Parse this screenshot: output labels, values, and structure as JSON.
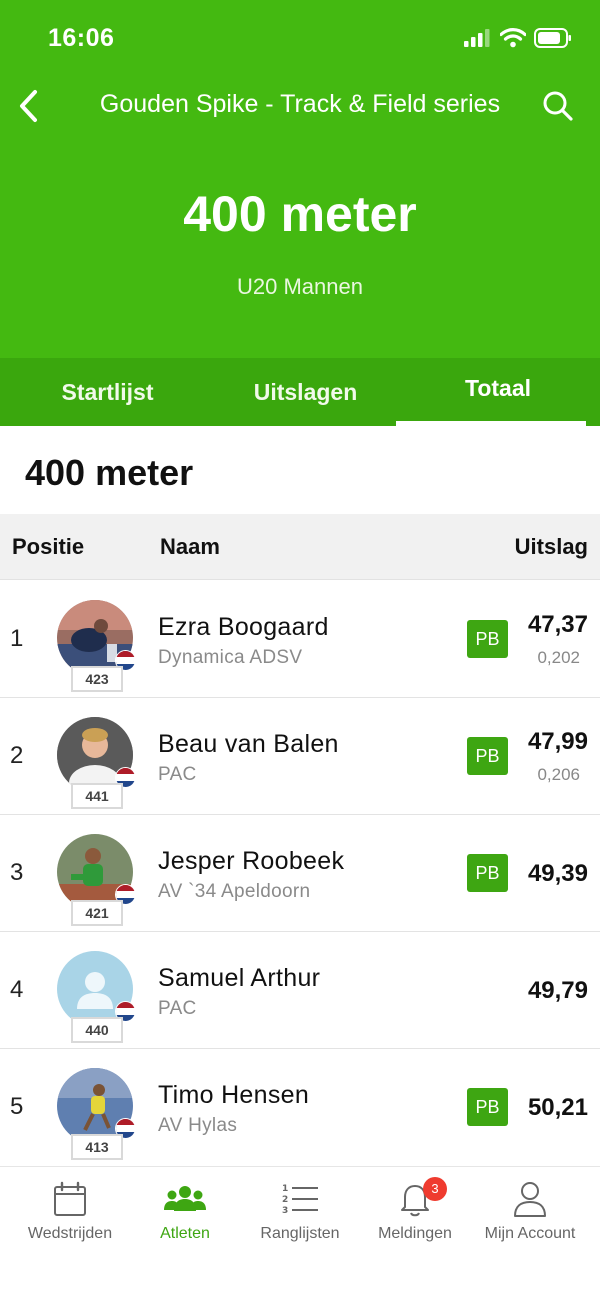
{
  "status": {
    "time": "16:06"
  },
  "nav": {
    "title": "Gouden Spike - Track & Field series"
  },
  "event": {
    "name": "400 meter",
    "category": "U20 Mannen"
  },
  "tabs": [
    {
      "label": "Startlijst",
      "active": false
    },
    {
      "label": "Uitslagen",
      "active": false
    },
    {
      "label": "Totaal",
      "active": true
    }
  ],
  "section_title": "400 meter",
  "table": {
    "headers": {
      "position": "Positie",
      "name": "Naam",
      "result": "Uitslag"
    },
    "rows": [
      {
        "rank": "1",
        "name": "Ezra Boogaard",
        "club": "Dynamica ADSV",
        "bib": "423",
        "pb": "PB",
        "time": "47,37",
        "reaction": "0,202"
      },
      {
        "rank": "2",
        "name": "Beau van Balen",
        "club": "PAC",
        "bib": "441",
        "pb": "PB",
        "time": "47,99",
        "reaction": "0,206"
      },
      {
        "rank": "3",
        "name": "Jesper Roobeek",
        "club": "AV `34 Apeldoorn",
        "bib": "421",
        "pb": "PB",
        "time": "49,39",
        "reaction": ""
      },
      {
        "rank": "4",
        "name": "Samuel Arthur",
        "club": "PAC",
        "bib": "440",
        "pb": "",
        "time": "49,79",
        "reaction": ""
      },
      {
        "rank": "5",
        "name": "Timo Hensen",
        "club": "AV Hylas",
        "bib": "413",
        "pb": "PB",
        "time": "50,21",
        "reaction": ""
      }
    ]
  },
  "bottom_nav": [
    {
      "label": "Wedstrijden",
      "icon": "calendar-icon",
      "active": false
    },
    {
      "label": "Atleten",
      "icon": "people-icon",
      "active": true
    },
    {
      "label": "Ranglijsten",
      "icon": "ranked-list-icon",
      "active": false
    },
    {
      "label": "Meldingen",
      "icon": "bell-icon",
      "active": false,
      "badge": "3"
    },
    {
      "label": "Mijn Account",
      "icon": "user-icon",
      "active": false
    }
  ],
  "colors": {
    "header_green": "#44b911",
    "tab_bar_green": "#3aa70d",
    "pb_badge": "#3ea612",
    "notification_badge": "#ef3b2f",
    "flag_red": "#ae1c28",
    "flag_blue": "#21468b"
  }
}
